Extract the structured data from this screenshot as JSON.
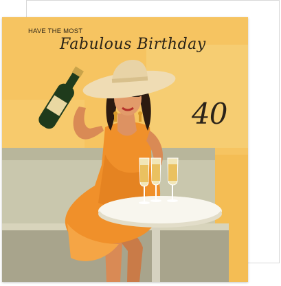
{
  "card": {
    "pre_title": "HAVE THE MOST",
    "title": "Fabulous Birthday",
    "age": "40"
  },
  "colors": {
    "background_yellow": "#f4bd54",
    "dress_orange": "#f0902a",
    "hat_cream": "#efdcb4",
    "sofa_grey": "#c9c7ad",
    "text_dark": "#2a2317"
  }
}
